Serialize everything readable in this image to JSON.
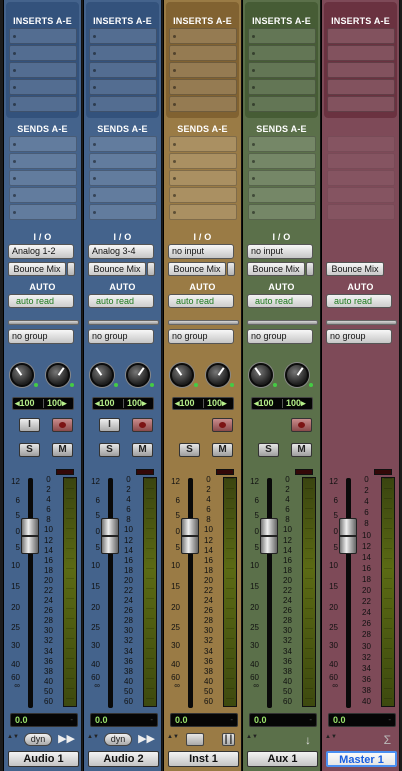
{
  "channels": [
    {
      "name": "Audio 1",
      "selected": false,
      "color": "#44638c",
      "hdr_color": "#26466f",
      "inserts_label": "INSERTS A-E",
      "sends_label": "SENDS A-E",
      "io_label": "I / O",
      "input": "Analog 1-2",
      "output": "Bounce Mix",
      "auto_label": "AUTO",
      "auto_mode": "auto read",
      "group": "no group",
      "pan_left": "◂100",
      "pan_right": "100▸",
      "input_button": "I",
      "solo": "S",
      "mute": "M",
      "volume": "0.0",
      "delay": "-",
      "footer_btn": "dyn",
      "footer_icon": "fast-forward-icon"
    },
    {
      "name": "Audio 2",
      "selected": false,
      "color": "#44638c",
      "hdr_color": "#26466f",
      "inserts_label": "INSERTS A-E",
      "sends_label": "SENDS A-E",
      "io_label": "I / O",
      "input": "Analog 3-4",
      "output": "Bounce Mix",
      "auto_label": "AUTO",
      "auto_mode": "auto read",
      "group": "no group",
      "pan_left": "◂100",
      "pan_right": "100▸",
      "input_button": "I",
      "solo": "S",
      "mute": "M",
      "volume": "0.0",
      "delay": "-",
      "footer_btn": "dyn",
      "footer_icon": "fast-forward-icon"
    },
    {
      "name": "Inst 1",
      "selected": false,
      "color": "#9a7b45",
      "hdr_color": "#6e4f21",
      "inserts_label": "INSERTS A-E",
      "sends_label": "SENDS A-E",
      "io_label": "I / O",
      "input": "no input",
      "output": "Bounce Mix",
      "auto_label": "AUTO",
      "auto_mode": "auto read",
      "group": "no group",
      "pan_left": "◂100",
      "pan_right": "100▸",
      "input_button": "",
      "solo": "S",
      "mute": "M",
      "volume": "0.0",
      "delay": "-",
      "footer_btn": "",
      "footer_icon": "midi-keyboard-icon"
    },
    {
      "name": "Aux 1",
      "selected": false,
      "color": "#5b704a",
      "hdr_color": "#344c24",
      "inserts_label": "INSERTS A-E",
      "sends_label": "SENDS A-E",
      "io_label": "I / O",
      "input": "no input",
      "output": "Bounce Mix",
      "auto_label": "AUTO",
      "auto_mode": "auto read",
      "group": "no group",
      "pan_left": "◂100",
      "pan_right": "100▸",
      "input_button": "",
      "solo": "S",
      "mute": "M",
      "volume": "0.0",
      "delay": "-",
      "footer_btn": "",
      "footer_icon": "arrow-down-icon"
    },
    {
      "name": "Master 1",
      "selected": true,
      "color": "#7e4a58",
      "hdr_color": "#5a1f2e",
      "inserts_label": "INSERTS A-E",
      "sends_label": "",
      "io_label": "",
      "input": "",
      "output": "Bounce Mix",
      "auto_label": "AUTO",
      "auto_mode": "auto read",
      "group": "no group",
      "pan_left": "",
      "pan_right": "",
      "input_button": "",
      "solo": "",
      "mute": "",
      "volume": "0.0",
      "delay": "-",
      "footer_btn": "",
      "footer_icon": "sigma-icon"
    }
  ],
  "fader_scale": [
    "12",
    "6",
    "5",
    "0",
    "5",
    "10",
    "15",
    "20",
    "25",
    "30",
    "40",
    "60",
    "∞"
  ],
  "meter_scale": [
    "0",
    "2",
    "4",
    "6",
    "8",
    "10",
    "12",
    "14",
    "16",
    "18",
    "20",
    "22",
    "24",
    "26",
    "28",
    "30",
    "32",
    "34",
    "36",
    "38",
    "40",
    "50",
    "60"
  ],
  "master_meter_scale": [
    "0",
    "2",
    "4",
    "6",
    "8",
    "10",
    "12",
    "14",
    "16",
    "18",
    "20",
    "22",
    "24",
    "26",
    "28",
    "30",
    "32",
    "34",
    "36",
    "38",
    "40"
  ]
}
